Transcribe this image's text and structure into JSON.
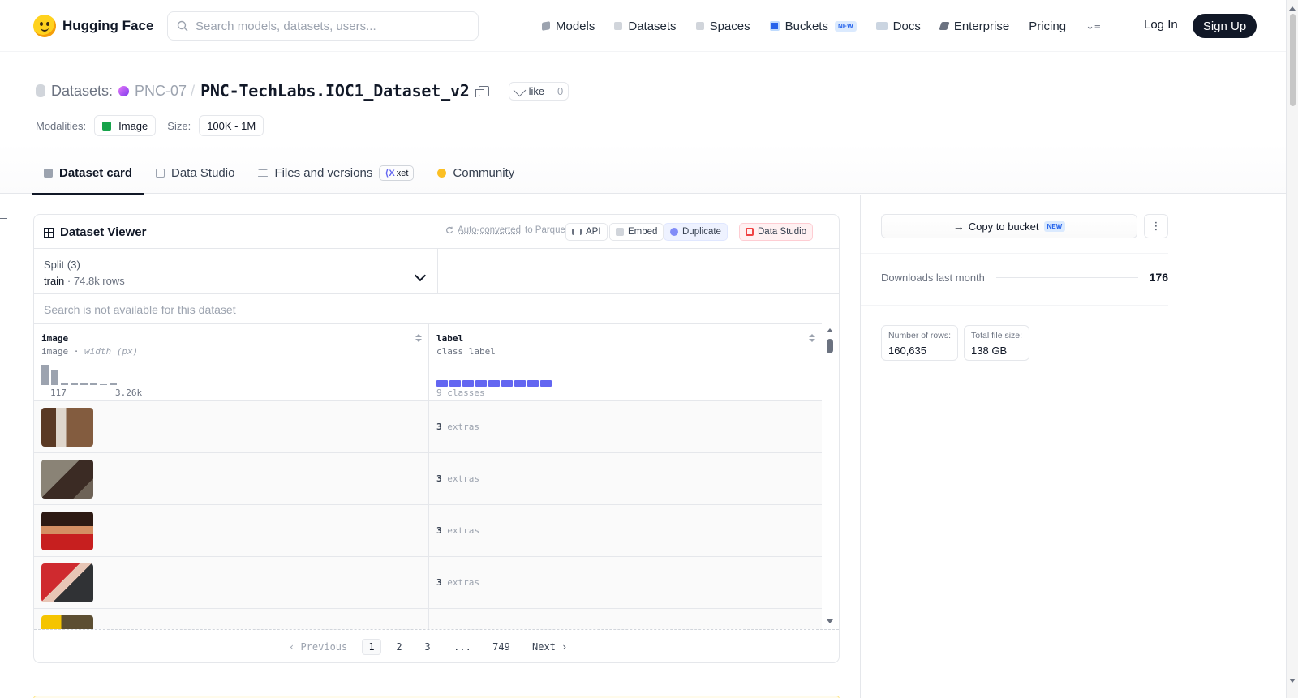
{
  "header": {
    "brand": "Hugging Face",
    "search_placeholder": "Search models, datasets, users...",
    "nav": {
      "models": "Models",
      "datasets": "Datasets",
      "spaces": "Spaces",
      "buckets": "Buckets",
      "buckets_badge": "NEW",
      "docs": "Docs",
      "enterprise": "Enterprise",
      "pricing": "Pricing"
    },
    "login": "Log In",
    "signup": "Sign Up"
  },
  "repo": {
    "section": "Datasets:",
    "org": "PNC-07",
    "separator": "/",
    "name": "PNC-TechLabs.IOC1_Dataset_v2",
    "like_label": "like",
    "like_count": "0"
  },
  "meta": {
    "modalities_label": "Modalities:",
    "modality": "Image",
    "size_label": "Size:",
    "size": "100K - 1M"
  },
  "tabs": {
    "dataset_card": "Dataset card",
    "data_studio": "Data Studio",
    "files": "Files and versions",
    "xet": "xet",
    "community": "Community"
  },
  "viewer": {
    "title": "Dataset Viewer",
    "auto_converted": "Auto-converted",
    "to_parquet": "to Parquet",
    "buttons": {
      "api": "API",
      "embed": "Embed",
      "duplicate": "Duplicate",
      "data_studio": "Data Studio"
    },
    "split_label": "Split (3)",
    "split_value": "train",
    "split_separator": "·",
    "split_rows": "74.8k rows",
    "search_unavailable": "Search is not available for this dataset",
    "columns": {
      "image": {
        "name": "image",
        "type": "image",
        "type_detail": "width (px)",
        "min": "117",
        "max": "3.26k",
        "histogram": [
          1.0,
          0.72,
          0.06,
          0.06,
          0.06,
          0.06,
          0.0,
          0.06
        ]
      },
      "label": {
        "name": "label",
        "type": "class label",
        "classes": "9 classes",
        "class_count": 9
      }
    },
    "rows": [
      {
        "label_value": "3",
        "label_extra": "extras"
      },
      {
        "label_value": "3",
        "label_extra": "extras"
      },
      {
        "label_value": "3",
        "label_extra": "extras"
      },
      {
        "label_value": "3",
        "label_extra": "extras"
      }
    ],
    "pagination": {
      "previous": "Previous",
      "pages": [
        "1",
        "2",
        "3",
        "...",
        "749"
      ],
      "next": "Next"
    }
  },
  "sidebar": {
    "copy_to_bucket": "Copy to bucket",
    "copy_badge": "NEW",
    "downloads_label": "Downloads last month",
    "downloads_value": "176",
    "rows_label": "Number of rows:",
    "rows_value": "160,635",
    "filesize_label": "Total file size:",
    "filesize_value": "138 GB"
  },
  "colors": {
    "accent": "#6366f1",
    "brand": "#ffd21e",
    "dark": "#111827"
  }
}
